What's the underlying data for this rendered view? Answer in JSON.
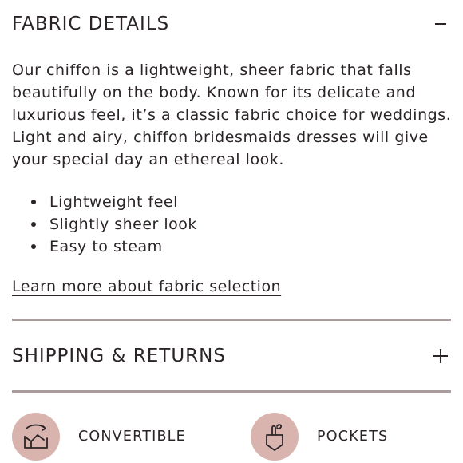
{
  "fabric_details": {
    "title": "FABRIC DETAILS",
    "toggle": "−",
    "description": "Our chiffon is a lightweight, sheer fabric that falls beautifully on the body. Known for its delicate and luxurious feel, it’s a classic fabric choice for weddings. Light and airy, chiffon bridesmaids dresses will give your special day an ethereal look.",
    "bullets": [
      "Lightweight feel",
      "Slightly sheer look",
      "Easy to steam"
    ],
    "link": "Learn more about fabric selection"
  },
  "shipping_returns": {
    "title": "SHIPPING & RETURNS",
    "toggle": "+"
  },
  "features": [
    {
      "label": "CONVERTIBLE",
      "icon": "convertible-dress-icon"
    },
    {
      "label": "POCKETS",
      "icon": "pocket-icon"
    }
  ],
  "colors": {
    "text": "#2b2426",
    "divider": "#a89d9c",
    "icon_circle": "#d9b3ae"
  }
}
